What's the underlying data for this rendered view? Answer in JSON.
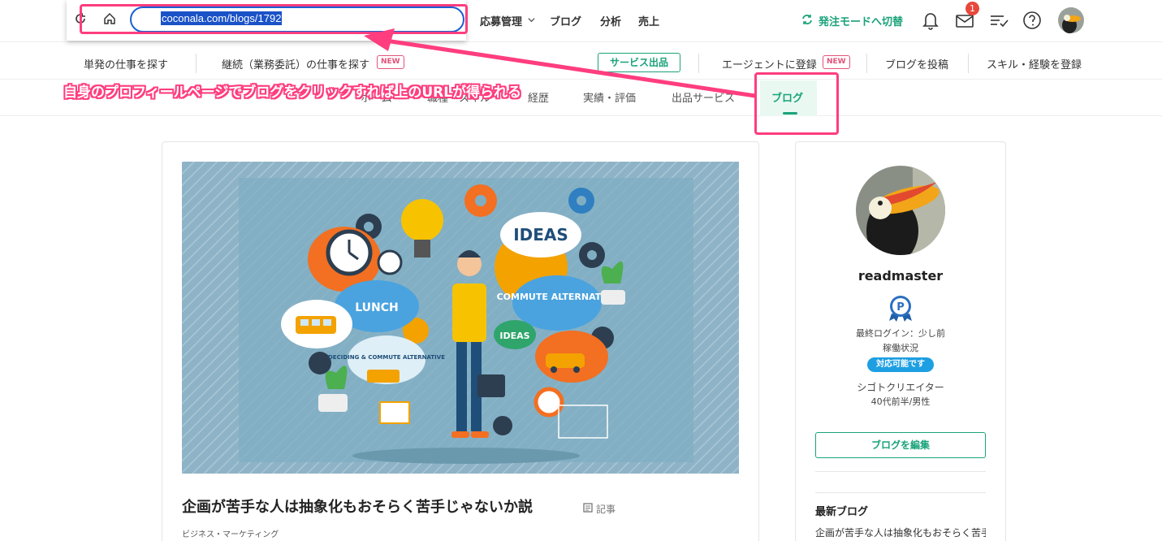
{
  "browser": {
    "url": "coconala.com/blogs/1792"
  },
  "header": {
    "nav": [
      "応募管理",
      "ブログ",
      "分析",
      "売上"
    ],
    "switch_label": "発注モードへ切替",
    "mail_count": "1"
  },
  "subnav": {
    "find_single": "単発の仕事を探す",
    "find_continuous": "継続（業務委託）の仕事を探す",
    "new_badge": "NEW",
    "service_btn": "サービス出品",
    "agent": "エージェントに登録",
    "post_blog": "ブログを投稿",
    "register_skill": "スキル・経験を登録"
  },
  "tabs": {
    "home": "ホーム",
    "skill": "職種・スキル",
    "career": "経歴",
    "results": "実績・評価",
    "services": "出品サービス",
    "blog": "ブログ"
  },
  "annotation": {
    "text": "自身のプロフィールページでブログをクリックすれば上のURLが得られる",
    "color": "#ff3d7f"
  },
  "article": {
    "title": "企画が苦手な人は抽象化もおそらく苦手じゃないか説",
    "type": "記事",
    "category": "ビジネス・マーケティング",
    "image_texts": {
      "ideas": "IDEAS",
      "lunch": "LUNCH",
      "commute": "COMMUTE ALTERNATIVE",
      "deciding": "DECIDING & COMMUTE ALTERNATIVE",
      "ideas2": "IDEAS"
    }
  },
  "profile": {
    "username": "readmaster",
    "last_login": "最終ログイン：少し前",
    "status_label": "稼働状況",
    "availability": "対応可能です",
    "title": "シゴトクリエイター",
    "demographic": "40代前半/男性",
    "edit_blog": "ブログを編集",
    "latest_heading": "最新ブログ",
    "latest_item": "企画が苦手な人は抽象化もおそらく苦手じゃないか説"
  },
  "colors": {
    "brand": "#1aa37a",
    "accent_red": "#ff3d7f",
    "available_blue": "#1e9fe2"
  }
}
